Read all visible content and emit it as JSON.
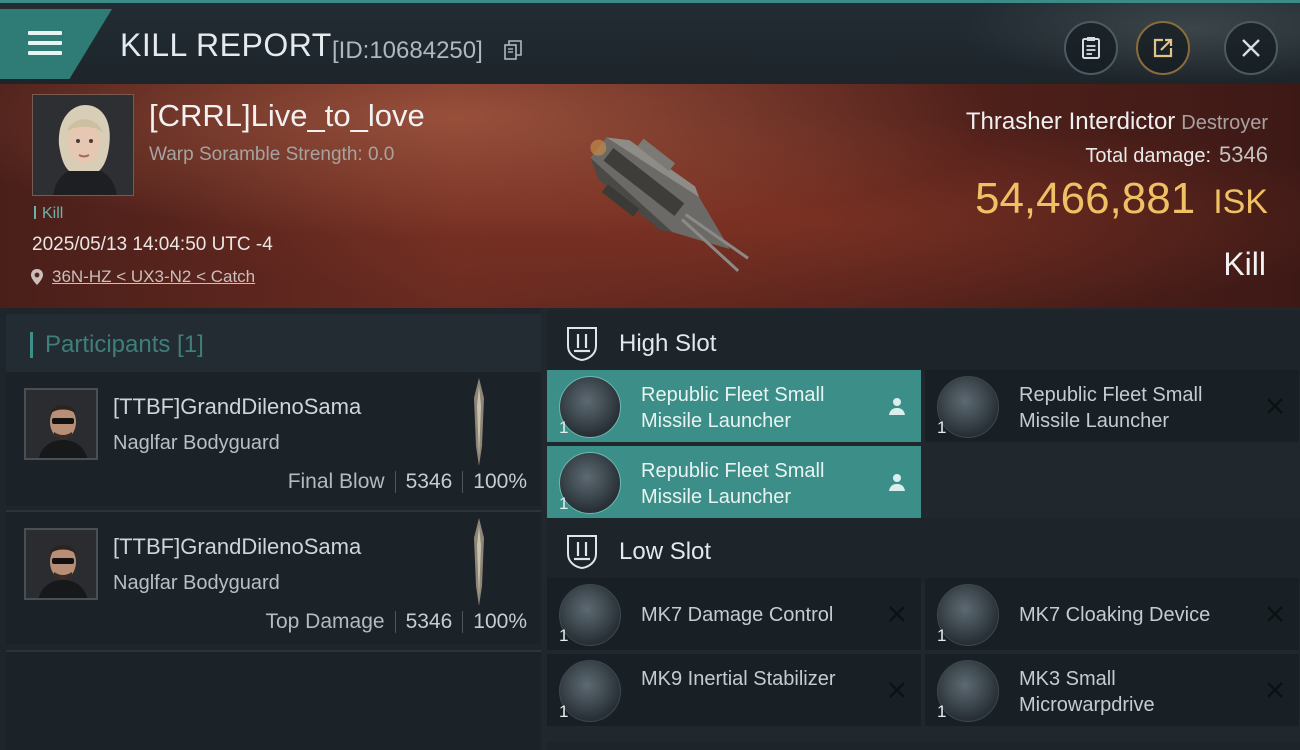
{
  "header": {
    "title": "KILL REPORT",
    "report_id": "[ID:10684250]"
  },
  "victim": {
    "name": "[CRRL]Live_to_love",
    "scramble": "Warp Soramble Strength: 0.0",
    "tag": "Kill",
    "datetime": "2025/05/13 14:04:50 UTC -4",
    "location": "36N-HZ < UX3-N2 < Catch"
  },
  "ship": {
    "name": "Thrasher Interdictor",
    "class": "Destroyer",
    "total_damage_label": "Total damage:",
    "total_damage": "5346",
    "isk_value": "54,466,881",
    "isk_unit": "ISK",
    "result": "Kill"
  },
  "participants": {
    "header": "Participants [1]",
    "rows": [
      {
        "name": "[TTBF]GrandDilenoSama",
        "ship": "Naglfar Bodyguard",
        "label": "Final Blow",
        "damage": "5346",
        "percent": "100%"
      },
      {
        "name": "[TTBF]GrandDilenoSama",
        "ship": "Naglfar Bodyguard",
        "label": "Top Damage",
        "damage": "5346",
        "percent": "100%"
      }
    ]
  },
  "fitting": {
    "high_slot": {
      "label": "High Slot",
      "modules": [
        {
          "name": "Republic Fleet Small Missile Launcher",
          "qty": "1",
          "status": "fitted-person-icon"
        },
        {
          "name": "Republic Fleet Small Missile Launcher",
          "qty": "1",
          "status": "destroyed-x-icon"
        },
        {
          "name": "Republic Fleet Small Missile Launcher",
          "qty": "1",
          "status": "fitted-person-icon"
        }
      ]
    },
    "low_slot": {
      "label": "Low Slot",
      "modules": [
        {
          "name": "MK7 Damage Control",
          "qty": "1",
          "status": "destroyed-x-icon"
        },
        {
          "name": "MK7 Cloaking Device",
          "qty": "1",
          "status": "destroyed-x-icon"
        },
        {
          "name": "MK9 Inertial Stabilizer",
          "qty": "1",
          "status": "destroyed-x-icon"
        },
        {
          "name": "MK3 Small Microwarpdrive",
          "qty": "1",
          "status": "destroyed-x-icon"
        }
      ]
    }
  },
  "colors": {
    "accent_teal": "#3c8f88",
    "isk_gold": "#f0c064",
    "banner_red": "#6a2b21"
  }
}
